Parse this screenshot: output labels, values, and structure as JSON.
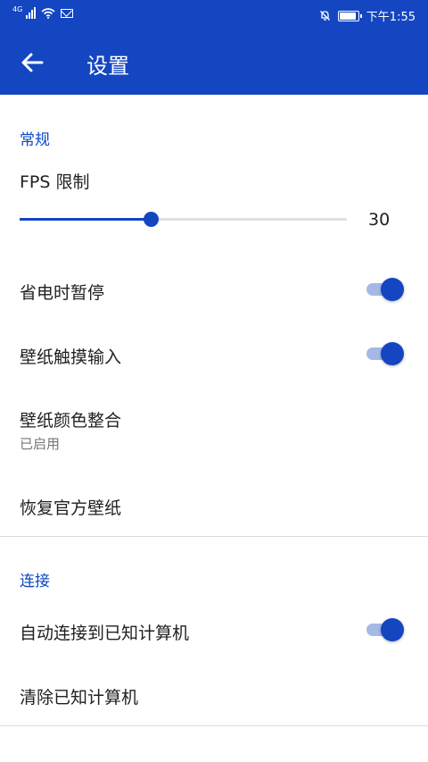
{
  "status_bar": {
    "network": "4G",
    "time": "下午1:55"
  },
  "app_bar": {
    "title": "设置"
  },
  "general": {
    "header": "常规",
    "fps": {
      "label": "FPS 限制",
      "value": "30",
      "fraction": 0.4
    },
    "pause_on_battery_saver": {
      "label": "省电时暂停",
      "enabled": true
    },
    "wallpaper_touch_input": {
      "label": "壁纸触摸输入",
      "enabled": true
    },
    "wallpaper_color_integration": {
      "label": "壁纸颜色整合",
      "status": "已启用"
    },
    "restore_official_wallpaper": {
      "label": "恢复官方壁纸"
    }
  },
  "connection": {
    "header": "连接",
    "auto_connect": {
      "label": "自动连接到已知计算机",
      "enabled": true
    },
    "clear_known": {
      "label": "清除已知计算机"
    }
  },
  "colors": {
    "accent": "#1446c2",
    "section_header": "#0b47c2",
    "toggle_track_on": "#a6b8e6"
  }
}
